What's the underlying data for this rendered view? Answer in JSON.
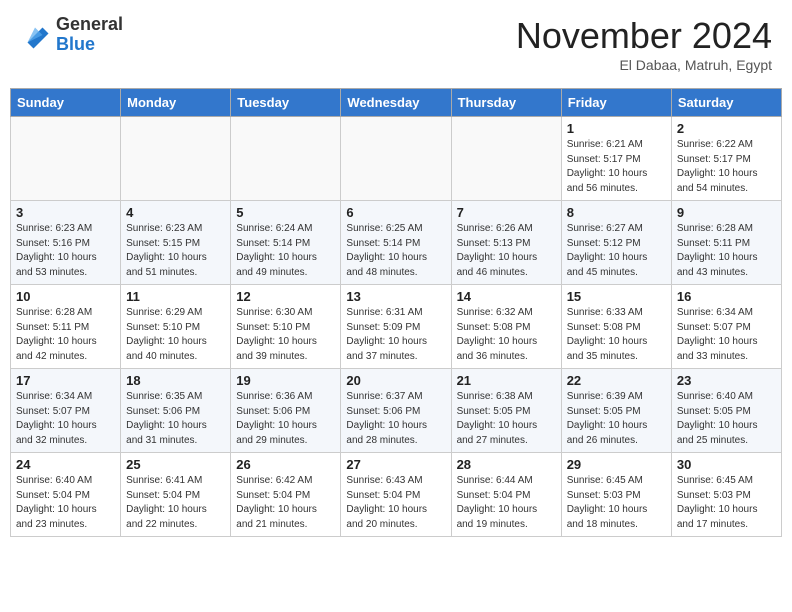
{
  "header": {
    "logo_general": "General",
    "logo_blue": "Blue",
    "month_title": "November 2024",
    "subtitle": "El Dabaa, Matruh, Egypt"
  },
  "weekdays": [
    "Sunday",
    "Monday",
    "Tuesday",
    "Wednesday",
    "Thursday",
    "Friday",
    "Saturday"
  ],
  "weeks": [
    [
      {
        "day": "",
        "info": ""
      },
      {
        "day": "",
        "info": ""
      },
      {
        "day": "",
        "info": ""
      },
      {
        "day": "",
        "info": ""
      },
      {
        "day": "",
        "info": ""
      },
      {
        "day": "1",
        "info": "Sunrise: 6:21 AM\nSunset: 5:17 PM\nDaylight: 10 hours\nand 56 minutes."
      },
      {
        "day": "2",
        "info": "Sunrise: 6:22 AM\nSunset: 5:17 PM\nDaylight: 10 hours\nand 54 minutes."
      }
    ],
    [
      {
        "day": "3",
        "info": "Sunrise: 6:23 AM\nSunset: 5:16 PM\nDaylight: 10 hours\nand 53 minutes."
      },
      {
        "day": "4",
        "info": "Sunrise: 6:23 AM\nSunset: 5:15 PM\nDaylight: 10 hours\nand 51 minutes."
      },
      {
        "day": "5",
        "info": "Sunrise: 6:24 AM\nSunset: 5:14 PM\nDaylight: 10 hours\nand 49 minutes."
      },
      {
        "day": "6",
        "info": "Sunrise: 6:25 AM\nSunset: 5:14 PM\nDaylight: 10 hours\nand 48 minutes."
      },
      {
        "day": "7",
        "info": "Sunrise: 6:26 AM\nSunset: 5:13 PM\nDaylight: 10 hours\nand 46 minutes."
      },
      {
        "day": "8",
        "info": "Sunrise: 6:27 AM\nSunset: 5:12 PM\nDaylight: 10 hours\nand 45 minutes."
      },
      {
        "day": "9",
        "info": "Sunrise: 6:28 AM\nSunset: 5:11 PM\nDaylight: 10 hours\nand 43 minutes."
      }
    ],
    [
      {
        "day": "10",
        "info": "Sunrise: 6:28 AM\nSunset: 5:11 PM\nDaylight: 10 hours\nand 42 minutes."
      },
      {
        "day": "11",
        "info": "Sunrise: 6:29 AM\nSunset: 5:10 PM\nDaylight: 10 hours\nand 40 minutes."
      },
      {
        "day": "12",
        "info": "Sunrise: 6:30 AM\nSunset: 5:10 PM\nDaylight: 10 hours\nand 39 minutes."
      },
      {
        "day": "13",
        "info": "Sunrise: 6:31 AM\nSunset: 5:09 PM\nDaylight: 10 hours\nand 37 minutes."
      },
      {
        "day": "14",
        "info": "Sunrise: 6:32 AM\nSunset: 5:08 PM\nDaylight: 10 hours\nand 36 minutes."
      },
      {
        "day": "15",
        "info": "Sunrise: 6:33 AM\nSunset: 5:08 PM\nDaylight: 10 hours\nand 35 minutes."
      },
      {
        "day": "16",
        "info": "Sunrise: 6:34 AM\nSunset: 5:07 PM\nDaylight: 10 hours\nand 33 minutes."
      }
    ],
    [
      {
        "day": "17",
        "info": "Sunrise: 6:34 AM\nSunset: 5:07 PM\nDaylight: 10 hours\nand 32 minutes."
      },
      {
        "day": "18",
        "info": "Sunrise: 6:35 AM\nSunset: 5:06 PM\nDaylight: 10 hours\nand 31 minutes."
      },
      {
        "day": "19",
        "info": "Sunrise: 6:36 AM\nSunset: 5:06 PM\nDaylight: 10 hours\nand 29 minutes."
      },
      {
        "day": "20",
        "info": "Sunrise: 6:37 AM\nSunset: 5:06 PM\nDaylight: 10 hours\nand 28 minutes."
      },
      {
        "day": "21",
        "info": "Sunrise: 6:38 AM\nSunset: 5:05 PM\nDaylight: 10 hours\nand 27 minutes."
      },
      {
        "day": "22",
        "info": "Sunrise: 6:39 AM\nSunset: 5:05 PM\nDaylight: 10 hours\nand 26 minutes."
      },
      {
        "day": "23",
        "info": "Sunrise: 6:40 AM\nSunset: 5:05 PM\nDaylight: 10 hours\nand 25 minutes."
      }
    ],
    [
      {
        "day": "24",
        "info": "Sunrise: 6:40 AM\nSunset: 5:04 PM\nDaylight: 10 hours\nand 23 minutes."
      },
      {
        "day": "25",
        "info": "Sunrise: 6:41 AM\nSunset: 5:04 PM\nDaylight: 10 hours\nand 22 minutes."
      },
      {
        "day": "26",
        "info": "Sunrise: 6:42 AM\nSunset: 5:04 PM\nDaylight: 10 hours\nand 21 minutes."
      },
      {
        "day": "27",
        "info": "Sunrise: 6:43 AM\nSunset: 5:04 PM\nDaylight: 10 hours\nand 20 minutes."
      },
      {
        "day": "28",
        "info": "Sunrise: 6:44 AM\nSunset: 5:04 PM\nDaylight: 10 hours\nand 19 minutes."
      },
      {
        "day": "29",
        "info": "Sunrise: 6:45 AM\nSunset: 5:03 PM\nDaylight: 10 hours\nand 18 minutes."
      },
      {
        "day": "30",
        "info": "Sunrise: 6:45 AM\nSunset: 5:03 PM\nDaylight: 10 hours\nand 17 minutes."
      }
    ]
  ]
}
